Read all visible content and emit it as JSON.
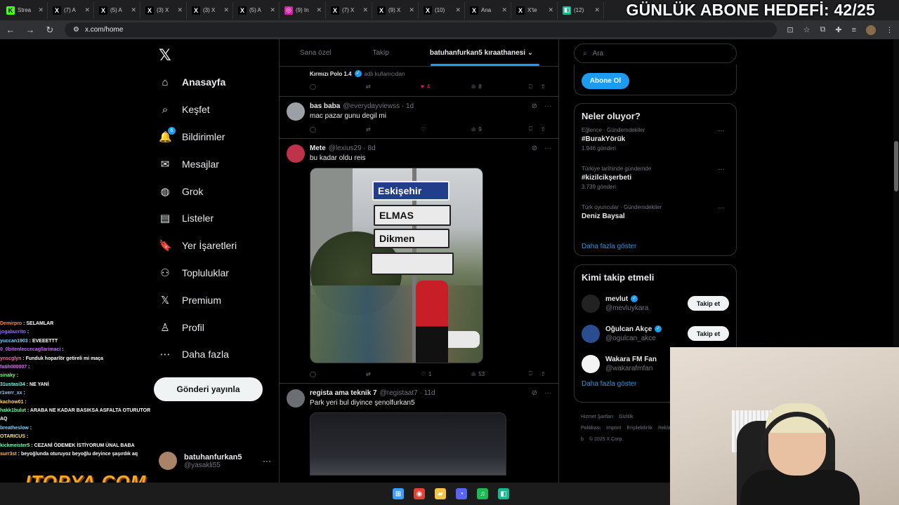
{
  "browser": {
    "tabs": [
      {
        "label": "Strea",
        "fav": "K",
        "color": "#53fc18",
        "text": "#000"
      },
      {
        "label": "(7) A",
        "fav": "X",
        "color": "#000",
        "text": "#fff"
      },
      {
        "label": "(5) A",
        "fav": "X",
        "color": "#000",
        "text": "#fff"
      },
      {
        "label": "(3) X",
        "fav": "X",
        "color": "#000",
        "text": "#fff"
      },
      {
        "label": "(3) X",
        "fav": "X",
        "color": "#000",
        "text": "#fff"
      },
      {
        "label": "(5) A",
        "fav": "X",
        "color": "#000",
        "text": "#fff"
      },
      {
        "label": "(9) In",
        "fav": "◎",
        "color": "#d6249f",
        "text": "#fff"
      },
      {
        "label": "(7) X",
        "fav": "X",
        "color": "#000",
        "text": "#fff"
      },
      {
        "label": "(9) X",
        "fav": "X",
        "color": "#000",
        "text": "#fff"
      },
      {
        "label": "(10)",
        "fav": "X",
        "color": "#000",
        "text": "#fff"
      },
      {
        "label": "Ana",
        "fav": "X",
        "color": "#000",
        "text": "#fff"
      },
      {
        "label": "X'te",
        "fav": "X",
        "color": "#000",
        "text": "#fff"
      },
      {
        "label": "(12)",
        "fav": "◧",
        "color": "#17b890",
        "text": "#fff"
      }
    ],
    "tab_close": "✕",
    "url": "x.com/home",
    "goal_overlay": "GÜNLÜK ABONE HEDEFİ: 42/25"
  },
  "chat": [
    {
      "user": "Demirpro",
      "msg": "SELAMLAR",
      "color": "#ff8a3d"
    },
    {
      "user": "jogaburrito",
      "msg": "",
      "color": "#9b6bff"
    },
    {
      "user": "yuccan1903",
      "msg": "EVEEETTT",
      "color": "#7fd1ff"
    },
    {
      "user": "0_0bitenleccecagllarimaci",
      "msg": "",
      "color": "#c36bff"
    },
    {
      "user": "ynscglyn",
      "msg": "Funduk hoparlör getireli mi maça",
      "color": "#ff6fb5"
    },
    {
      "user": "fatih000007",
      "msg": "",
      "color": "#d86bff"
    },
    {
      "user": "sinaky",
      "msg": "",
      "color": "#7cff7c"
    },
    {
      "user": "31ustasi34",
      "msg": "NE YANİ",
      "color": "#6bffea"
    },
    {
      "user": "r1verr_xx",
      "msg": "",
      "color": "#a0c4ff"
    },
    {
      "user": "kachow01",
      "msg": "",
      "color": "#ffd36b"
    },
    {
      "user": "hakk1bulut",
      "msg": "ARABA NE KADAR BASIKSA ASFALTA OTURUTOR AQ",
      "color": "#6bff9e"
    },
    {
      "user": "breatheslow",
      "msg": "",
      "color": "#7fd1ff"
    },
    {
      "user": "OTARICUS",
      "msg": "",
      "color": "#ffe66b"
    },
    {
      "user": "kickmeister5",
      "msg": "CEZANİ ÖDEMEK İSTİYORUM ÜNAL BABA",
      "color": "#6bffb0"
    },
    {
      "user": "surr3st",
      "msg": "beyoğlunda oturuyoz beyoğlu deyince şaşırdık aq",
      "color": "#ffb86b"
    }
  ],
  "overlay_logo": "ITOPYA.COM",
  "nav": {
    "logo": "𝕏",
    "items": [
      {
        "icon": "⌂",
        "label": "Anasayfa",
        "name": "home"
      },
      {
        "icon": "⌕",
        "label": "Keşfet",
        "name": "explore"
      },
      {
        "icon": "🔔",
        "label": "Bildirimler",
        "name": "notifications",
        "badge": "6"
      },
      {
        "icon": "✉",
        "label": "Mesajlar",
        "name": "messages"
      },
      {
        "icon": "◍",
        "label": "Grok",
        "name": "grok"
      },
      {
        "icon": "▤",
        "label": "Listeler",
        "name": "lists"
      },
      {
        "icon": "🔖",
        "label": "Yer İşaretleri",
        "name": "bookmarks"
      },
      {
        "icon": "⚇",
        "label": "Topluluklar",
        "name": "communities"
      },
      {
        "icon": "𝕏",
        "label": "Premium",
        "name": "premium"
      },
      {
        "icon": "♙",
        "label": "Profil",
        "name": "profile"
      },
      {
        "icon": "⋯",
        "label": "Daha fazla",
        "name": "more"
      }
    ],
    "post_button": "Gönderi yayınla",
    "account": {
      "name": "batuhanfurkan5",
      "handle": "@yasakli55",
      "menu": "···"
    }
  },
  "timeline": {
    "tabs": [
      "Sana özel",
      "Takip",
      "batuhanfurkan5 kıraathanesi"
    ],
    "tab_chevron": "⌄",
    "partial_top": {
      "name": "Kırmızı Polo 1.4",
      "sub": "adlı kullanıcıdan",
      "likes": "4",
      "views": "8"
    },
    "tweets": [
      {
        "name": "bas baba",
        "handle": "@everydayviewss · 1d",
        "text": "mac pazar gunu degil mi",
        "likes": "",
        "views": "9",
        "av_color": "#9aa0a6"
      },
      {
        "name": "Mete",
        "handle": "@lexius29 · 8d",
        "text": "bu kadar oldu reis",
        "likes": "1",
        "views": "53",
        "av_color": "#c0324a",
        "signs": [
          "Eskişehir",
          "ELMAS",
          "Dikmen",
          ""
        ]
      },
      {
        "name": "regista ama teknik 7",
        "handle": "@registaat7 · 11d",
        "text": "Park yeri bul diyince şenolfurkan5",
        "av_color": "#6b6f73"
      }
    ],
    "icons": {
      "reply": "◯",
      "repost": "⇄",
      "like": "♡",
      "liked": "♥",
      "views": "ılı",
      "bookmark": "⎕",
      "share": "⇧",
      "grok": "⊘",
      "more": "···"
    }
  },
  "right": {
    "search_icon": "⌕",
    "search_placeholder": "Ara",
    "subscribe_button": "Abone Ol",
    "trends_title": "Neler oluyor?",
    "trends": [
      {
        "context": "Eğlence · Gündemdekiler",
        "topic": "#BurakYörük",
        "posts": "1.946 gönderi"
      },
      {
        "context": "Türkiye tarihinde gündemde",
        "topic": "#kizilcikşerbeti",
        "posts": "3.739 gönderi"
      },
      {
        "context": "Türk oyuncular · Gündemdekiler",
        "topic": "Deniz Baysal",
        "posts": ""
      }
    ],
    "show_more": "Daha fazla göster",
    "who_title": "Kimi takip etmeli",
    "who": [
      {
        "name": "mevlut",
        "handle": "@mevluykara",
        "button": "Takip et",
        "verified": true,
        "av_color": "#222"
      },
      {
        "name": "Oğulcan Akçe",
        "handle": "@ogulcan_akce",
        "button": "Takip et",
        "verified": true,
        "av_color": "#2a4d8f"
      },
      {
        "name": "Wakara FM Fan",
        "handle": "@wakarafmfan",
        "button": "",
        "verified": false,
        "av_color": "#f3f3f3"
      }
    ],
    "who_more": "Daha fazla göster",
    "footer": [
      "Hizmet Şartları",
      "Gizlilik Politikası",
      "Imprint",
      "Erişilebilirlik",
      "Reklam b",
      "© 2025 X Corp."
    ]
  },
  "taskbar": [
    {
      "icon": "⊞",
      "color": "#3aa0ff",
      "name": "start"
    },
    {
      "icon": "◉",
      "color": "#e34133",
      "name": "chrome"
    },
    {
      "icon": "▰",
      "color": "#f4c542",
      "name": "files"
    },
    {
      "icon": "◔",
      "color": "#5865f2",
      "name": "discord"
    },
    {
      "icon": "♫",
      "color": "#1db954",
      "name": "spotify"
    },
    {
      "icon": "◧",
      "color": "#17b890",
      "name": "app"
    }
  ]
}
